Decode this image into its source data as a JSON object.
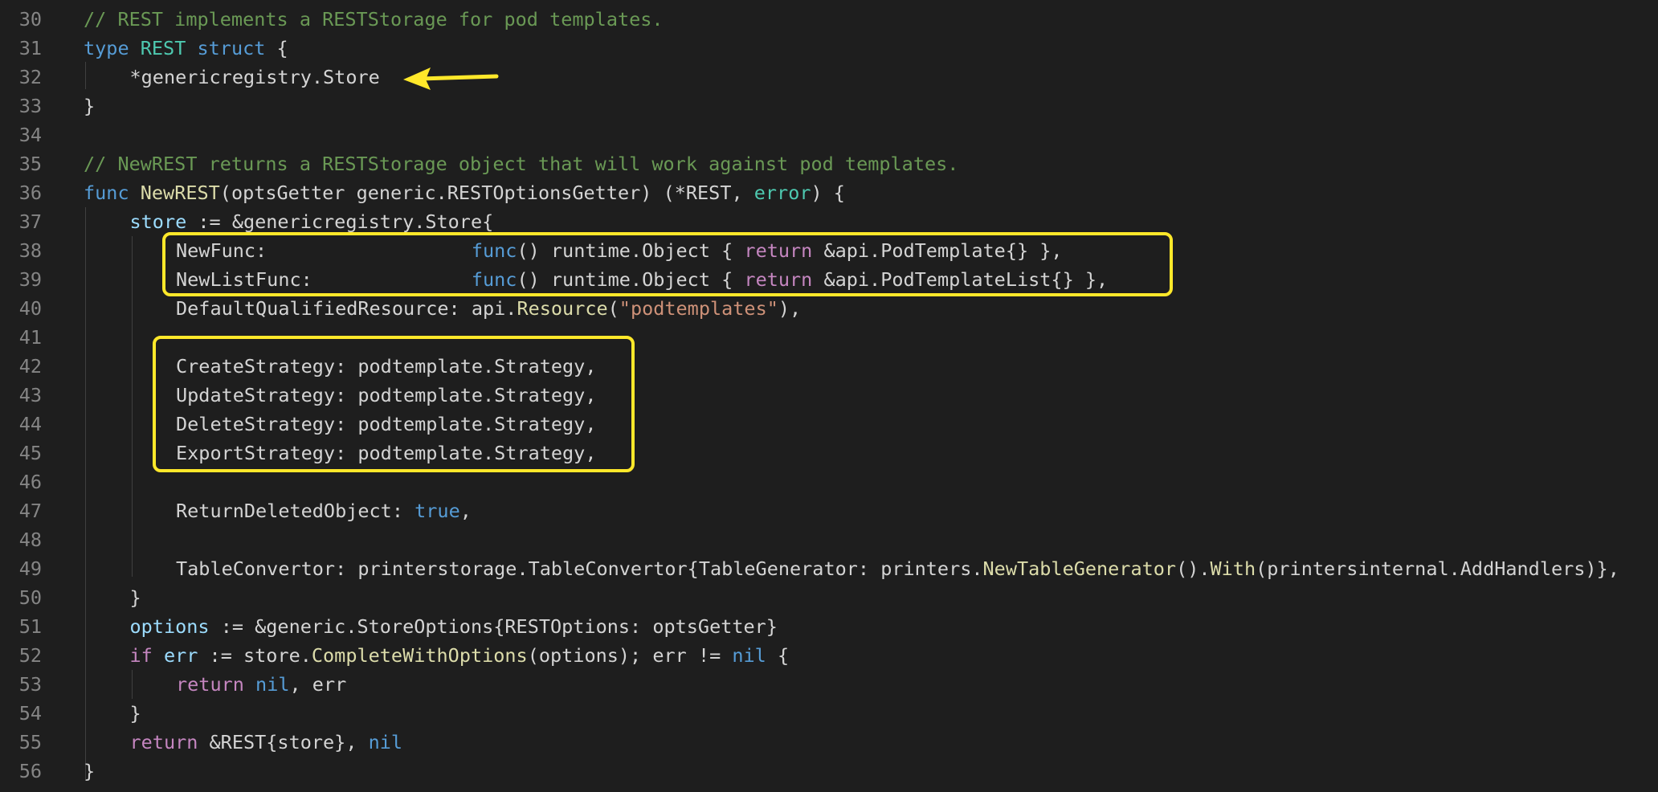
{
  "editor": {
    "lines": [
      {
        "n": "30",
        "indent": 0,
        "tokens": [
          {
            "t": "// REST implements a RESTStorage for pod templates.",
            "k": "comment"
          }
        ]
      },
      {
        "n": "31",
        "indent": 0,
        "tokens": [
          {
            "t": "type",
            "k": "kw"
          },
          {
            "t": " ",
            "k": "plain"
          },
          {
            "t": "REST",
            "k": "type"
          },
          {
            "t": " ",
            "k": "plain"
          },
          {
            "t": "struct",
            "k": "kw"
          },
          {
            "t": " {",
            "k": "plain"
          }
        ]
      },
      {
        "n": "32",
        "indent": 1,
        "tokens": [
          {
            "t": "*genericregistry.Store",
            "k": "plain"
          }
        ]
      },
      {
        "n": "33",
        "indent": 0,
        "tokens": [
          {
            "t": "}",
            "k": "plain"
          }
        ]
      },
      {
        "n": "34",
        "indent": 0,
        "tokens": []
      },
      {
        "n": "35",
        "indent": 0,
        "tokens": [
          {
            "t": "// NewREST returns a RESTStorage object that will work against pod templates.",
            "k": "comment"
          }
        ]
      },
      {
        "n": "36",
        "indent": 0,
        "tokens": [
          {
            "t": "func",
            "k": "kw"
          },
          {
            "t": " ",
            "k": "plain"
          },
          {
            "t": "NewREST",
            "k": "fn"
          },
          {
            "t": "(optsGetter generic.RESTOptionsGetter) (*REST, ",
            "k": "plain"
          },
          {
            "t": "error",
            "k": "type"
          },
          {
            "t": ") {",
            "k": "plain"
          }
        ]
      },
      {
        "n": "37",
        "indent": 1,
        "tokens": [
          {
            "t": "store",
            "k": "var"
          },
          {
            "t": " := &genericregistry.Store{",
            "k": "plain"
          }
        ]
      },
      {
        "n": "38",
        "indent": 2,
        "tokens": [
          {
            "t": "NewFunc:                  ",
            "k": "plain"
          },
          {
            "t": "func",
            "k": "kw"
          },
          {
            "t": "() runtime.Object { ",
            "k": "plain"
          },
          {
            "t": "return",
            "k": "ctl"
          },
          {
            "t": " &api.PodTemplate{} },",
            "k": "plain"
          }
        ]
      },
      {
        "n": "39",
        "indent": 2,
        "tokens": [
          {
            "t": "NewListFunc:              ",
            "k": "plain"
          },
          {
            "t": "func",
            "k": "kw"
          },
          {
            "t": "() runtime.Object { ",
            "k": "plain"
          },
          {
            "t": "return",
            "k": "ctl"
          },
          {
            "t": " &api.PodTemplateList{} },",
            "k": "plain"
          }
        ]
      },
      {
        "n": "40",
        "indent": 2,
        "tokens": [
          {
            "t": "DefaultQualifiedResource: api.",
            "k": "plain"
          },
          {
            "t": "Resource",
            "k": "fn"
          },
          {
            "t": "(",
            "k": "plain"
          },
          {
            "t": "\"podtemplates\"",
            "k": "str"
          },
          {
            "t": "),",
            "k": "plain"
          }
        ]
      },
      {
        "n": "41",
        "indent": 0,
        "tokens": []
      },
      {
        "n": "42",
        "indent": 2,
        "tokens": [
          {
            "t": "CreateStrategy: podtemplate.Strategy,",
            "k": "plain"
          }
        ]
      },
      {
        "n": "43",
        "indent": 2,
        "tokens": [
          {
            "t": "UpdateStrategy: podtemplate.Strategy,",
            "k": "plain"
          }
        ]
      },
      {
        "n": "44",
        "indent": 2,
        "tokens": [
          {
            "t": "DeleteStrategy: podtemplate.Strategy,",
            "k": "plain"
          }
        ]
      },
      {
        "n": "45",
        "indent": 2,
        "tokens": [
          {
            "t": "ExportStrategy: podtemplate.Strategy,",
            "k": "plain"
          }
        ]
      },
      {
        "n": "46",
        "indent": 0,
        "tokens": []
      },
      {
        "n": "47",
        "indent": 2,
        "tokens": [
          {
            "t": "ReturnDeletedObject: ",
            "k": "plain"
          },
          {
            "t": "true",
            "k": "kw"
          },
          {
            "t": ",",
            "k": "plain"
          }
        ]
      },
      {
        "n": "48",
        "indent": 0,
        "tokens": []
      },
      {
        "n": "49",
        "indent": 2,
        "tokens": [
          {
            "t": "TableConvertor: printerstorage.TableConvertor{TableGenerator: printers.",
            "k": "plain"
          },
          {
            "t": "NewTableGenerator",
            "k": "fn"
          },
          {
            "t": "().",
            "k": "plain"
          },
          {
            "t": "With",
            "k": "fn"
          },
          {
            "t": "(printersinternal.AddHandlers)},",
            "k": "plain"
          }
        ]
      },
      {
        "n": "50",
        "indent": 1,
        "tokens": [
          {
            "t": "}",
            "k": "plain"
          }
        ]
      },
      {
        "n": "51",
        "indent": 1,
        "tokens": [
          {
            "t": "options",
            "k": "var"
          },
          {
            "t": " := &generic.StoreOptions{RESTOptions: optsGetter}",
            "k": "plain"
          }
        ]
      },
      {
        "n": "52",
        "indent": 1,
        "tokens": [
          {
            "t": "if",
            "k": "ctl"
          },
          {
            "t": " ",
            "k": "plain"
          },
          {
            "t": "err",
            "k": "var"
          },
          {
            "t": " := store.",
            "k": "plain"
          },
          {
            "t": "CompleteWithOptions",
            "k": "fn"
          },
          {
            "t": "(options); err != ",
            "k": "plain"
          },
          {
            "t": "nil",
            "k": "kw"
          },
          {
            "t": " {",
            "k": "plain"
          }
        ]
      },
      {
        "n": "53",
        "indent": 2,
        "tokens": [
          {
            "t": "return",
            "k": "ctl"
          },
          {
            "t": " ",
            "k": "plain"
          },
          {
            "t": "nil",
            "k": "kw"
          },
          {
            "t": ", err",
            "k": "plain"
          }
        ]
      },
      {
        "n": "54",
        "indent": 1,
        "tokens": [
          {
            "t": "}",
            "k": "plain"
          }
        ]
      },
      {
        "n": "55",
        "indent": 1,
        "tokens": [
          {
            "t": "return",
            "k": "ctl"
          },
          {
            "t": " &REST{store}, ",
            "k": "plain"
          },
          {
            "t": "nil",
            "k": "kw"
          }
        ]
      },
      {
        "n": "56",
        "indent": 0,
        "tokens": [
          {
            "t": "}",
            "k": "plain"
          }
        ]
      }
    ]
  },
  "colors": {
    "background": "#1e1e1e",
    "highlight": "#ffe82a"
  },
  "annotations": {
    "arrow_icon": "arrow-left-icon",
    "boxes": [
      "newfunc-highlight-box",
      "strategy-highlight-box"
    ]
  }
}
